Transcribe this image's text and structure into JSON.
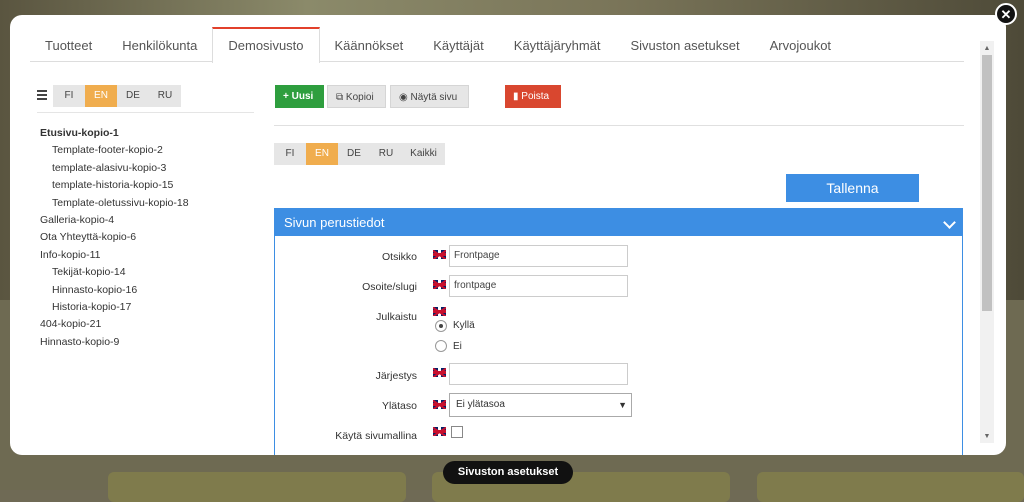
{
  "tabs": [
    "Tuotteet",
    "Henkilökunta",
    "Demosivusto",
    "Käännökset",
    "Käyttäjät",
    "Käyttäjäryhmät",
    "Sivuston asetukset",
    "Arvojoukot"
  ],
  "active_tab": "Demosivusto",
  "close_label": "✕",
  "left_langs": [
    "FI",
    "EN",
    "DE",
    "RU"
  ],
  "left_active_lang": "EN",
  "tree": [
    {
      "label": "Etusivu-kopio-1",
      "level": 0,
      "bold": true
    },
    {
      "label": "Template-footer-kopio-2",
      "level": 1
    },
    {
      "label": "template-alasivu-kopio-3",
      "level": 1
    },
    {
      "label": "template-historia-kopio-15",
      "level": 1
    },
    {
      "label": "Template-oletussivu-kopio-18",
      "level": 1
    },
    {
      "label": "Galleria-kopio-4",
      "level": 0
    },
    {
      "label": "Ota Yhteyttä-kopio-6",
      "level": 0
    },
    {
      "label": "Info-kopio-11",
      "level": 0
    },
    {
      "label": "Tekijät-kopio-14",
      "level": 1
    },
    {
      "label": "Hinnasto-kopio-16",
      "level": 1
    },
    {
      "label": "Historia-kopio-17",
      "level": 1
    },
    {
      "label": "404-kopio-21",
      "level": 0
    },
    {
      "label": "Hinnasto-kopio-9",
      "level": 0
    }
  ],
  "actions": {
    "new": "+ Uusi",
    "copy": "Kopioi",
    "show": "Näytä sivu",
    "delete": "Poista"
  },
  "edit_langs": [
    "FI",
    "EN",
    "DE",
    "RU",
    "Kaikki"
  ],
  "edit_active_lang": "EN",
  "save_label": "Tallenna",
  "panel_title": "Sivun perustiedot",
  "form": {
    "title_label": "Otsikko",
    "title_value": "Frontpage",
    "slug_label": "Osoite/slugi",
    "slug_value": "frontpage",
    "published_label": "Julkaistu",
    "published_yes": "Kyllä",
    "published_no": "Ei",
    "published_value": "Kyllä",
    "order_label": "Järjestys",
    "order_value": "",
    "parent_label": "Ylätaso",
    "parent_value": "Ei ylätasoa",
    "template_label": "Käytä sivumallina",
    "template_checked": false
  },
  "footer_label": "Sivuston asetukset",
  "colors": {
    "accent_blue": "#3d8ee3",
    "active_lang": "#f0ad4e",
    "new_green": "#2e9e3e",
    "delete_red": "#d9472f",
    "active_tab_border": "#e2402b"
  }
}
